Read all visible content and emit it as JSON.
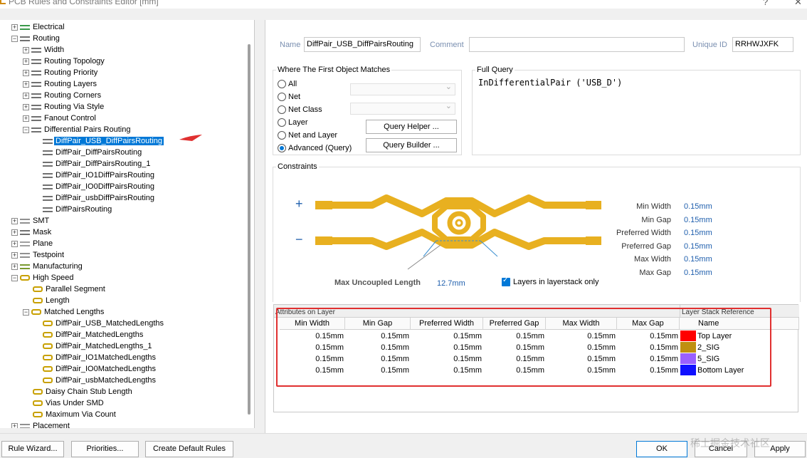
{
  "window": {
    "title": "PCB Rules and Constraints Editor [mm]",
    "help": "?",
    "close": "✕"
  },
  "tree": {
    "items": [
      {
        "label": "Electrical",
        "level": 0,
        "exp": "+",
        "icon": "electrical-icon"
      },
      {
        "label": "Routing",
        "level": 0,
        "exp": "−",
        "icon": "routing-icon"
      },
      {
        "label": "Width",
        "level": 1,
        "exp": "+",
        "icon": "routing-rule-icon"
      },
      {
        "label": "Routing Topology",
        "level": 1,
        "exp": "+",
        "icon": "routing-rule-icon"
      },
      {
        "label": "Routing Priority",
        "level": 1,
        "exp": "+",
        "icon": "routing-rule-icon"
      },
      {
        "label": "Routing Layers",
        "level": 1,
        "exp": "+",
        "icon": "routing-rule-icon"
      },
      {
        "label": "Routing Corners",
        "level": 1,
        "exp": "+",
        "icon": "routing-rule-icon"
      },
      {
        "label": "Routing Via Style",
        "level": 1,
        "exp": "+",
        "icon": "routing-rule-icon"
      },
      {
        "label": "Fanout Control",
        "level": 1,
        "exp": "+",
        "icon": "routing-rule-icon"
      },
      {
        "label": "Differential Pairs Routing",
        "level": 1,
        "exp": "−",
        "icon": "routing-rule-icon"
      },
      {
        "label": "DiffPair_USB_DiffPairsRouting",
        "level": 2,
        "exp": "",
        "icon": "rule-icon",
        "selected": true
      },
      {
        "label": "DiffPair_DiffPairsRouting",
        "level": 2,
        "exp": "",
        "icon": "rule-icon"
      },
      {
        "label": "DiffPair_DiffPairsRouting_1",
        "level": 2,
        "exp": "",
        "icon": "rule-icon"
      },
      {
        "label": "DiffPair_IO1DiffPairsRouting",
        "level": 2,
        "exp": "",
        "icon": "rule-icon"
      },
      {
        "label": "DiffPair_IO0DiffPairsRouting",
        "level": 2,
        "exp": "",
        "icon": "rule-icon"
      },
      {
        "label": "DiffPair_usbDiffPairsRouting",
        "level": 2,
        "exp": "",
        "icon": "rule-icon"
      },
      {
        "label": "DiffPairsRouting",
        "level": 2,
        "exp": "",
        "icon": "rule-icon"
      },
      {
        "label": "SMT",
        "level": 0,
        "exp": "+",
        "icon": "smt-icon"
      },
      {
        "label": "Mask",
        "level": 0,
        "exp": "+",
        "icon": "mask-icon"
      },
      {
        "label": "Plane",
        "level": 0,
        "exp": "+",
        "icon": "plane-icon"
      },
      {
        "label": "Testpoint",
        "level": 0,
        "exp": "+",
        "icon": "testpoint-icon"
      },
      {
        "label": "Manufacturing",
        "level": 0,
        "exp": "+",
        "icon": "manufacturing-icon"
      },
      {
        "label": "High Speed",
        "level": 0,
        "exp": "−",
        "icon": "high-speed-icon"
      },
      {
        "label": "Parallel Segment",
        "level": 1,
        "exp": "",
        "icon": "hs-rule-icon"
      },
      {
        "label": "Length",
        "level": 1,
        "exp": "",
        "icon": "hs-rule-icon"
      },
      {
        "label": "Matched Lengths",
        "level": 1,
        "exp": "−",
        "icon": "hs-rule-icon"
      },
      {
        "label": "DiffPair_USB_MatchedLengths",
        "level": 2,
        "exp": "",
        "icon": "hs-rule-icon"
      },
      {
        "label": "DiffPair_MatchedLengths",
        "level": 2,
        "exp": "",
        "icon": "hs-rule-icon"
      },
      {
        "label": "DiffPair_MatchedLengths_1",
        "level": 2,
        "exp": "",
        "icon": "hs-rule-icon"
      },
      {
        "label": "DiffPair_IO1MatchedLengths",
        "level": 2,
        "exp": "",
        "icon": "hs-rule-icon"
      },
      {
        "label": "DiffPair_IO0MatchedLengths",
        "level": 2,
        "exp": "",
        "icon": "hs-rule-icon"
      },
      {
        "label": "DiffPair_usbMatchedLengths",
        "level": 2,
        "exp": "",
        "icon": "hs-rule-icon"
      },
      {
        "label": "Daisy Chain Stub Length",
        "level": 1,
        "exp": "",
        "icon": "hs-rule-icon"
      },
      {
        "label": "Vias Under SMD",
        "level": 1,
        "exp": "",
        "icon": "hs-rule-icon"
      },
      {
        "label": "Maximum Via Count",
        "level": 1,
        "exp": "",
        "icon": "hs-rule-icon"
      },
      {
        "label": "Placement",
        "level": 0,
        "exp": "+",
        "icon": "placement-icon"
      }
    ]
  },
  "rule": {
    "name_label": "Name",
    "name_value": "DiffPair_USB_DiffPairsRouting",
    "comment_label": "Comment",
    "comment_value": "",
    "uid_label": "Unique ID",
    "uid_value": "RRHWJXFK"
  },
  "match": {
    "title": "Where The First Object Matches",
    "options": [
      "All",
      "Net",
      "Net Class",
      "Layer",
      "Net and Layer",
      "Advanced (Query)"
    ],
    "selected": "Advanced (Query)",
    "query_helper": "Query Helper ...",
    "query_builder": "Query Builder ..."
  },
  "full_query": {
    "title": "Full Query",
    "text": "InDifferentialPair ('USB_D')"
  },
  "constraints": {
    "title": "Constraints",
    "plus": "+",
    "minus": "−",
    "rows": [
      {
        "label": "Min Width",
        "value": "0.15mm"
      },
      {
        "label": "Min Gap",
        "value": "0.15mm"
      },
      {
        "label": "Preferred Width",
        "value": "0.15mm"
      },
      {
        "label": "Preferred Gap",
        "value": "0.15mm"
      },
      {
        "label": "Max Width",
        "value": "0.15mm"
      },
      {
        "label": "Max Gap",
        "value": "0.15mm"
      }
    ],
    "max_uncoupled_label": "Max Uncoupled Length",
    "max_uncoupled_value": "12.7mm",
    "layers_only_label": "Layers in layerstack only",
    "layers_only_checked": true
  },
  "layer_grid": {
    "band_left": "Attributes on Layer",
    "band_right": "Layer Stack Reference",
    "columns": [
      "Min Width",
      "Min Gap",
      "Preferred Width",
      "Preferred Gap",
      "Max Width",
      "Max Gap",
      "Name"
    ],
    "rows": [
      {
        "values": [
          "0.15mm",
          "0.15mm",
          "0.15mm",
          "0.15mm",
          "0.15mm",
          "0.15mm"
        ],
        "color": "#ff0000",
        "name": "Top Layer"
      },
      {
        "values": [
          "0.15mm",
          "0.15mm",
          "0.15mm",
          "0.15mm",
          "0.15mm",
          "0.15mm"
        ],
        "color": "#c09010",
        "name": "2_SIG"
      },
      {
        "values": [
          "0.15mm",
          "0.15mm",
          "0.15mm",
          "0.15mm",
          "0.15mm",
          "0.15mm"
        ],
        "color": "#9a60ff",
        "name": "5_SIG"
      },
      {
        "values": [
          "0.15mm",
          "0.15mm",
          "0.15mm",
          "0.15mm",
          "0.15mm",
          "0.15mm"
        ],
        "color": "#1010ff",
        "name": "Bottom Layer"
      }
    ]
  },
  "buttons": {
    "rule_wizard": "Rule Wizard...",
    "priorities": "Priorities...",
    "create_default": "Create Default Rules",
    "ok": "OK",
    "cancel": "Cancel",
    "apply": "Apply"
  },
  "watermark": "稀土掘金技术社区",
  "colors": {
    "accent": "#0078d7",
    "trace": "#e8b020",
    "annotation": "#e03030"
  }
}
